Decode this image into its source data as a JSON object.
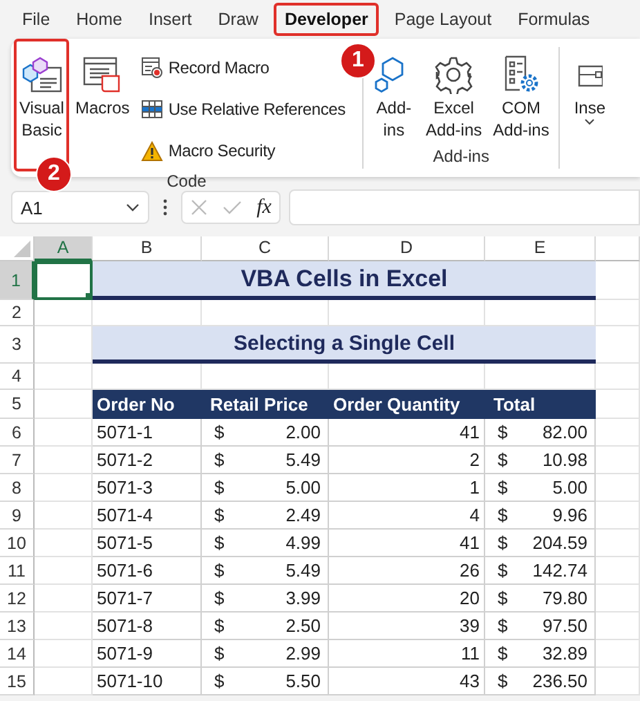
{
  "menu_tabs": [
    {
      "label": "File",
      "selected": false,
      "highlighted": false
    },
    {
      "label": "Home",
      "selected": false,
      "highlighted": false
    },
    {
      "label": "Insert",
      "selected": false,
      "highlighted": false
    },
    {
      "label": "Draw",
      "selected": false,
      "highlighted": false
    },
    {
      "label": "Developer",
      "selected": true,
      "highlighted": true
    },
    {
      "label": "Page Layout",
      "selected": false,
      "highlighted": false
    },
    {
      "label": "Formulas",
      "selected": false,
      "highlighted": false
    }
  ],
  "ribbon": {
    "groups": [
      {
        "label": "Code",
        "buttons": [
          {
            "kind": "large",
            "label": "Visual\nBasic",
            "highlighted": true
          },
          {
            "kind": "large",
            "label": "Macros",
            "highlighted": false
          },
          {
            "kind": "small",
            "label": "Record Macro",
            "highlighted": false
          },
          {
            "kind": "small",
            "label": "Use Relative References",
            "highlighted": false
          },
          {
            "kind": "small",
            "label": "Macro Security",
            "highlighted": false
          }
        ]
      },
      {
        "label": "Add-ins",
        "buttons": [
          {
            "kind": "large",
            "label": "Add-\nins",
            "highlighted": false
          },
          {
            "kind": "large",
            "label": "Excel\nAdd-ins",
            "highlighted": false
          },
          {
            "kind": "large",
            "label": "COM\nAdd-ins",
            "highlighted": false
          }
        ]
      },
      {
        "buttons": [
          {
            "kind": "dropdown",
            "label": "Inse",
            "highlighted": false
          }
        ]
      }
    ]
  },
  "callouts": [
    {
      "label": "1"
    },
    {
      "label": "2"
    }
  ],
  "formula_bar": {
    "name_box": "A1",
    "function_label": "fx"
  },
  "sheet": {
    "columns": [
      {
        "label": "A",
        "selected": true
      },
      {
        "label": "B",
        "selected": false
      },
      {
        "label": "C",
        "selected": false
      },
      {
        "label": "D",
        "selected": false
      },
      {
        "label": "E",
        "selected": false
      }
    ],
    "rows": [
      {
        "label": "1",
        "selected": true
      },
      {
        "label": "2",
        "selected": false
      },
      {
        "label": "3",
        "selected": false
      },
      {
        "label": "4",
        "selected": false
      },
      {
        "label": "5",
        "selected": false
      },
      {
        "label": "6",
        "selected": false
      },
      {
        "label": "7",
        "selected": false
      },
      {
        "label": "8",
        "selected": false
      },
      {
        "label": "9",
        "selected": false
      },
      {
        "label": "10",
        "selected": false
      },
      {
        "label": "11",
        "selected": false
      },
      {
        "label": "12",
        "selected": false
      },
      {
        "label": "13",
        "selected": false
      },
      {
        "label": "14",
        "selected": false
      },
      {
        "label": "15",
        "selected": false
      }
    ],
    "title": "VBA Cells in Excel",
    "subtitle": "Selecting a Single Cell",
    "table": {
      "columns": [
        "Order No",
        "Retail Price",
        "Order Quantity",
        "Total"
      ],
      "rows": [
        {
          "order": "5071-1",
          "price": {
            "symbol": "$",
            "amount": "2.00"
          },
          "quantity": "41",
          "total": {
            "symbol": "$",
            "amount": "82.00"
          }
        },
        {
          "order": "5071-2",
          "price": {
            "symbol": "$",
            "amount": "5.49"
          },
          "quantity": "2",
          "total": {
            "symbol": "$",
            "amount": "10.98"
          }
        },
        {
          "order": "5071-3",
          "price": {
            "symbol": "$",
            "amount": "5.00"
          },
          "quantity": "1",
          "total": {
            "symbol": "$",
            "amount": "5.00"
          }
        },
        {
          "order": "5071-4",
          "price": {
            "symbol": "$",
            "amount": "2.49"
          },
          "quantity": "4",
          "total": {
            "symbol": "$",
            "amount": "9.96"
          }
        },
        {
          "order": "5071-5",
          "price": {
            "symbol": "$",
            "amount": "4.99"
          },
          "quantity": "41",
          "total": {
            "symbol": "$",
            "amount": "204.59"
          }
        },
        {
          "order": "5071-6",
          "price": {
            "symbol": "$",
            "amount": "5.49"
          },
          "quantity": "26",
          "total": {
            "symbol": "$",
            "amount": "142.74"
          }
        },
        {
          "order": "5071-7",
          "price": {
            "symbol": "$",
            "amount": "3.99"
          },
          "quantity": "20",
          "total": {
            "symbol": "$",
            "amount": "79.80"
          }
        },
        {
          "order": "5071-8",
          "price": {
            "symbol": "$",
            "amount": "2.50"
          },
          "quantity": "39",
          "total": {
            "symbol": "$",
            "amount": "97.50"
          }
        },
        {
          "order": "5071-9",
          "price": {
            "symbol": "$",
            "amount": "2.99"
          },
          "quantity": "11",
          "total": {
            "symbol": "$",
            "amount": "32.89"
          }
        },
        {
          "order": "5071-10",
          "price": {
            "symbol": "$",
            "amount": "5.50"
          },
          "quantity": "43",
          "total": {
            "symbol": "$",
            "amount": "236.50"
          }
        }
      ]
    }
  }
}
